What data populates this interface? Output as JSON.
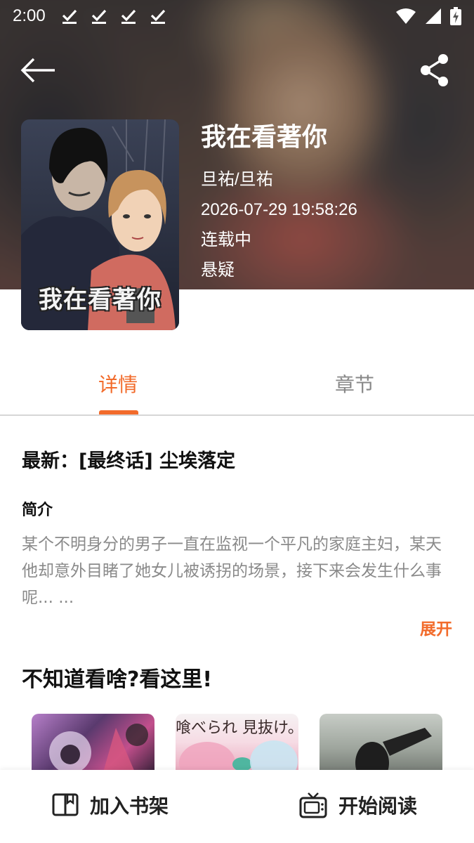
{
  "status_bar": {
    "time": "2:00",
    "download_icons": [
      "download-check-icon",
      "download-check-icon",
      "download-check-icon",
      "download-check-icon"
    ],
    "right_icons": [
      "wifi-icon",
      "signal-icon",
      "battery-charging-icon"
    ]
  },
  "top_bar": {
    "back_icon": "arrow-left-icon",
    "share_icon": "share-icon"
  },
  "comic": {
    "cover_title": "我在看著你",
    "title": "我在看著你",
    "author": "旦祐/旦祐",
    "updated": "2026-07-29 19:58:26",
    "status": "连载中",
    "genre": "悬疑"
  },
  "tabs": [
    {
      "label": "详情",
      "active": true
    },
    {
      "label": "章节",
      "active": false
    }
  ],
  "detail": {
    "latest": "最新：[最终话] 尘埃落定",
    "intro_heading": "简介",
    "intro_text": "某个不明身分的男子一直在监视一个平凡的家庭主妇，某天他却意外目睹了她女儿被诱拐的场景，接下来会发生什么事呢... ...",
    "expand_label": "展开"
  },
  "recommend": {
    "heading": "不知道看啥?看这里!",
    "items": [
      {
        "image": "cover-art-purple"
      },
      {
        "image": "cover-art-pink",
        "overlay_text": "喰べられ 見抜け。本物の"
      },
      {
        "image": "cover-art-gray"
      }
    ]
  },
  "bottom_bar": {
    "add_label": "加入书架",
    "add_icon": "bookshelf-icon",
    "read_label": "开始阅读",
    "read_icon": "tv-icon"
  },
  "colors": {
    "accent": "#f26b2b",
    "muted_text": "#8a8a8a",
    "divider": "#d6d6d6"
  }
}
